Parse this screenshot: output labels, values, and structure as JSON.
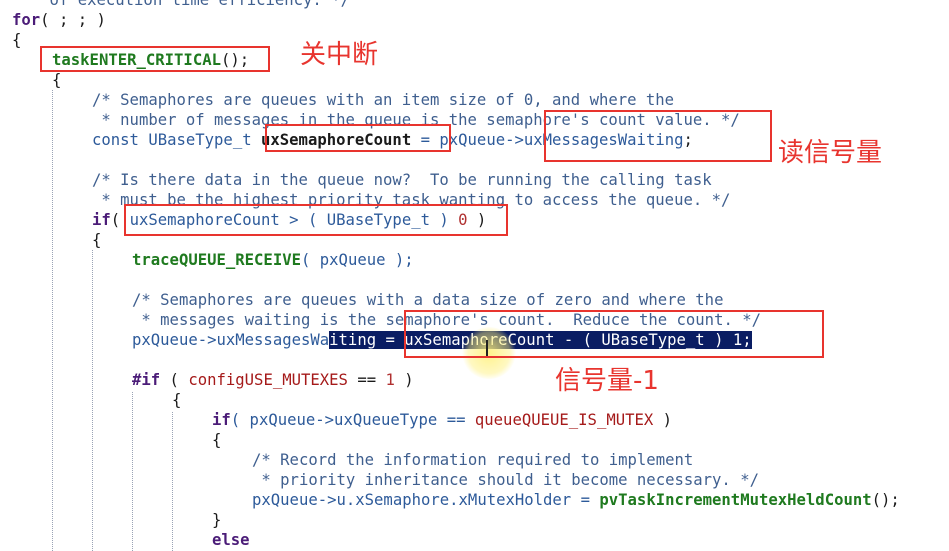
{
  "code": {
    "l0_comment": "    of execution time efficiency. */",
    "l1_for": "for",
    "l1_rest": "( ; ; )",
    "l2_brace": "{",
    "l3_fn": "taskENTER_CRITICAL",
    "l3_rest": "();",
    "l4_brace": "{",
    "l5_comment": "/* Semaphores are queues with an item size of 0, and where the",
    "l6_comment": " * number of messages in the queue is the semaphore's count value. */",
    "l7_const": "const UBaseType_t ",
    "l7_var": "uxSemaphoreCount",
    "l7_eq": " = pxQueue->",
    "l7_member": "uxMessagesWaiting",
    "l7_end": ";",
    "l9_comment": "/* Is there data in the queue now?  To be running the calling task",
    "l10_comment": " * must be the highest priority task wanting to access the queue. */",
    "l11_if": "if",
    "l11_paren": "( ",
    "l11_cond": "uxSemaphoreCount > ( UBaseType_t ) ",
    "l11_zero": "0",
    "l11_close": " )",
    "l12_brace": "{",
    "l13_fn": "traceQUEUE_RECEIVE",
    "l13_rest": "( pxQueue );",
    "l15_comment": "/* Semaphores are queues with a data size of zero and where the",
    "l16_comment": " * messages waiting is the semaphore's count.  Reduce the count. */",
    "l17_pre": "pxQueue->uxMessagesWa",
    "l17_sel": "iting = uxSemaphoreCount - ( UBaseType_t ) 1;",
    "l19_if": "#if",
    "l19_paren": " ( ",
    "l19_macro": "configUSE_MUTEXES",
    "l19_rest": " == ",
    "l19_one": "1",
    "l19_close": " )",
    "l20_brace": "{",
    "l21_if": "if",
    "l21_pre": "( pxQueue->uxQueueType == ",
    "l21_macro": "queueQUEUE_IS_MUTEX",
    "l21_close": " )",
    "l22_brace": "{",
    "l23_comment": "/* Record the information required to implement",
    "l24_comment": " * priority inheritance should it become necessary. */",
    "l25_pre": "pxQueue->u.xSemaphore.xMutexHolder = ",
    "l25_fn": "pvTaskIncrementMutexHeldCount",
    "l25_end": "();",
    "l26_brace": "}",
    "l27_else": "else"
  },
  "annotations": {
    "disable_interrupts": "关中断",
    "read_semaphore": "读信号量",
    "semaphore_minus_one": "信号量-1"
  },
  "colors": {
    "annotation_red": "#e8342e",
    "selection_bg": "#0a1d63",
    "function_green": "#1f7a1f",
    "keyword_purple": "#4b1c78",
    "comment_blue": "#3f5f8f"
  }
}
